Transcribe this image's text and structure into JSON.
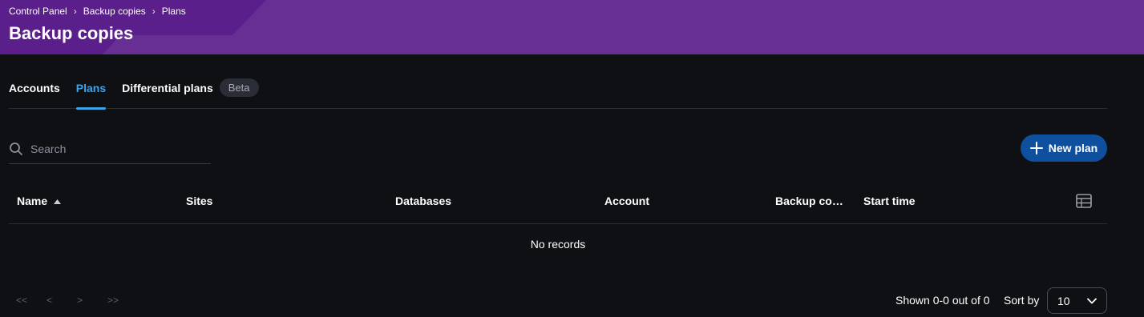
{
  "breadcrumb": [
    "Control Panel",
    "Backup copies",
    "Plans"
  ],
  "page": {
    "title": "Backup copies"
  },
  "tabs": [
    {
      "label": "Accounts",
      "active": false
    },
    {
      "label": "Plans",
      "active": true
    },
    {
      "label": "Differential plans",
      "active": false,
      "badge": "Beta"
    }
  ],
  "search": {
    "placeholder": "Search",
    "value": ""
  },
  "toolbar": {
    "new_plan_label": "New plan"
  },
  "table": {
    "columns": [
      "Name",
      "Sites",
      "Databases",
      "Account",
      "Backup copi…",
      "Start time"
    ],
    "sorted_column": "Name",
    "sort_direction": "ascending",
    "empty_text": "No records"
  },
  "pagination": {
    "first": "<<",
    "prev": "<",
    "next": ">",
    "last": ">>",
    "shown": "Shown 0-0 out of 0",
    "sort_by_label": "Sort by",
    "page_size": "10"
  },
  "colors": {
    "header": "#672f93",
    "header_accent": "#5a1f8a",
    "background": "#0f1014",
    "active_tab": "#3fa3e8",
    "primary_button": "#0e4f9e"
  },
  "icons": [
    "chevron-right-icon",
    "search-icon",
    "plus-icon",
    "sort-up-icon",
    "table-columns-icon",
    "chevron-down-icon"
  ]
}
